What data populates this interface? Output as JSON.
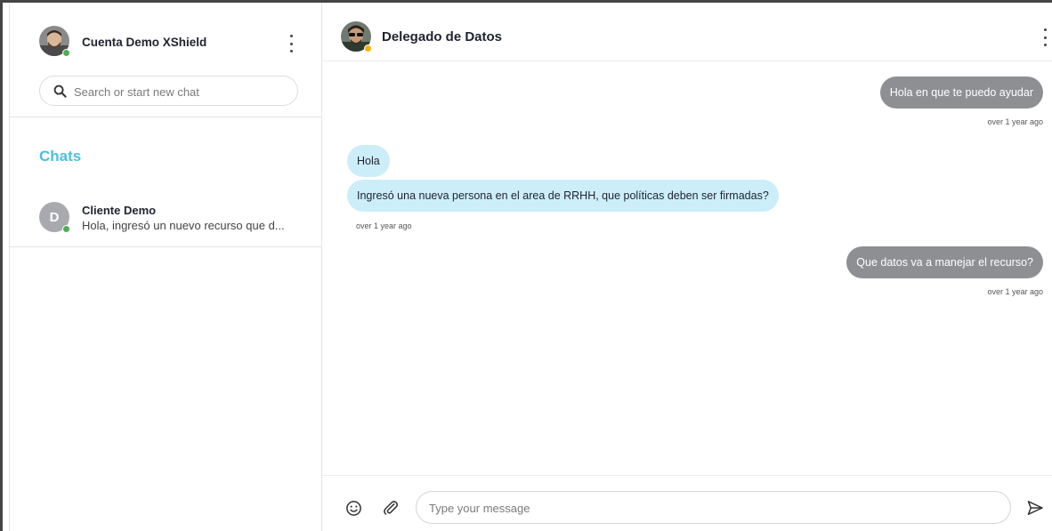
{
  "account": {
    "name": "Cuenta Demo XShield",
    "status_color": "#4caf50"
  },
  "search": {
    "placeholder": "Search or start new chat",
    "icon": "search-icon"
  },
  "chats_section": {
    "title": "Chats",
    "items": [
      {
        "initial": "D",
        "name": "Cliente Demo",
        "preview": "Hola, ingresó un nuevo recurso que d...",
        "status_color": "#4caf50"
      }
    ]
  },
  "conversation": {
    "title": "Delegado de Datos",
    "status_color": "#f4b400",
    "messages": [
      {
        "direction": "outgoing",
        "text": "Hola en que te puedo ayudar",
        "time": "over 1 year ago"
      },
      {
        "direction": "incoming",
        "text": "Hola",
        "time": ""
      },
      {
        "direction": "incoming",
        "text": "Ingresó una nueva persona en el area de RRHH, que políticas deben ser firmadas?",
        "time": "over 1 year ago"
      },
      {
        "direction": "outgoing",
        "text": "Que datos va a manejar el recurso?",
        "time": "over 1 year ago"
      }
    ]
  },
  "composer": {
    "placeholder": "Type your message",
    "icons": [
      "emoji-icon",
      "paperclip-icon",
      "send-icon"
    ]
  },
  "colors": {
    "accent": "#4dbfdc",
    "outgoing_bubble": "#8d8f93",
    "incoming_bubble": "#cceef8"
  }
}
